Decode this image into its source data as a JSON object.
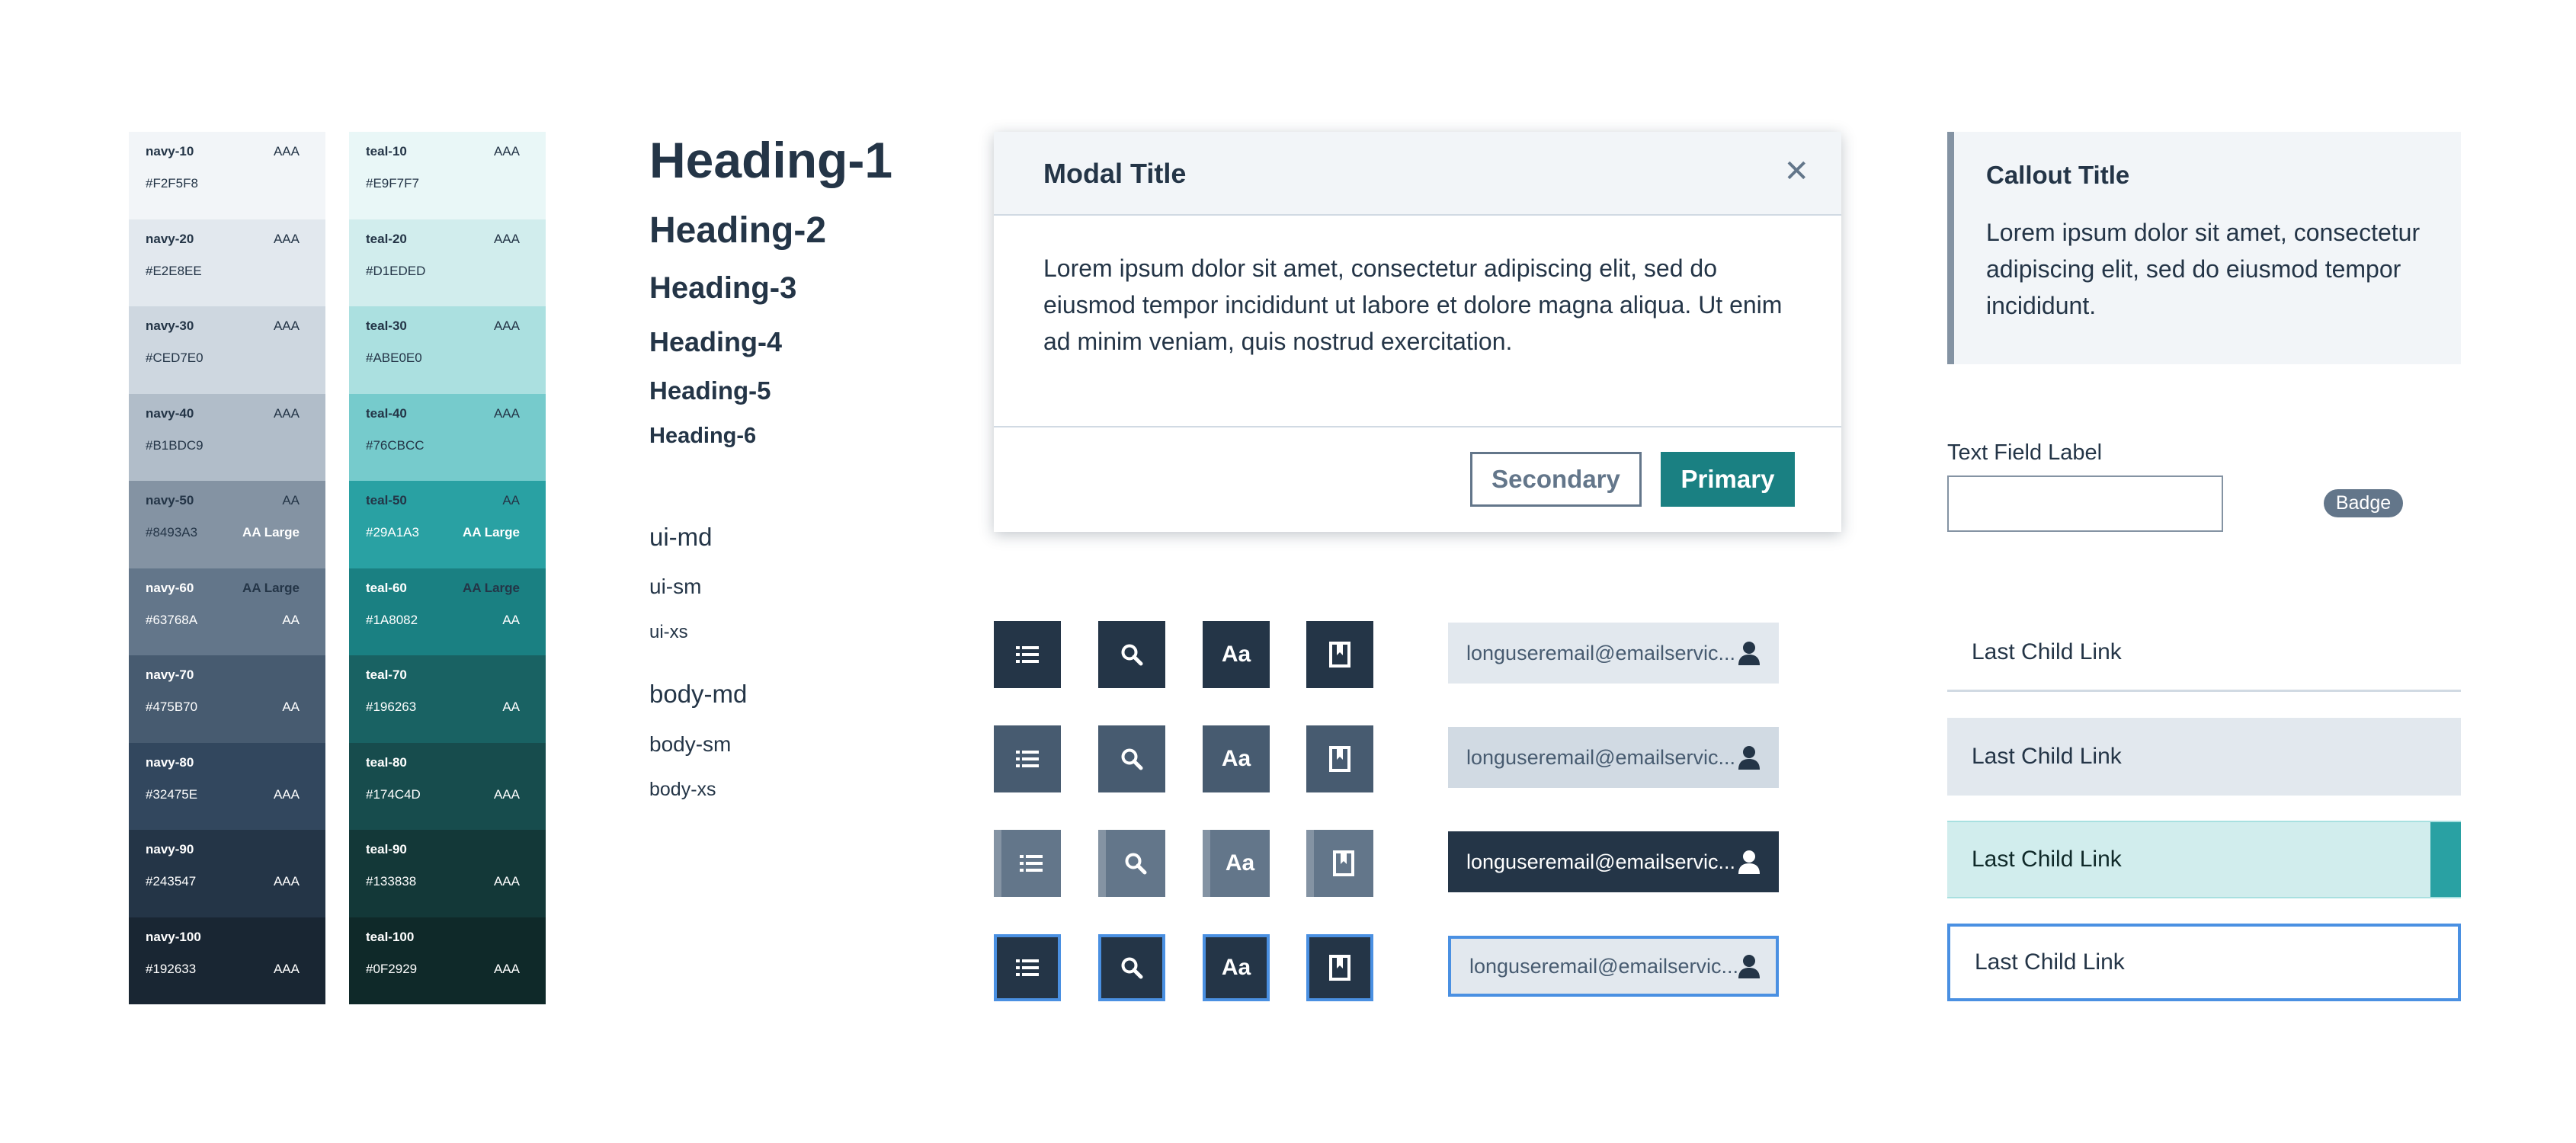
{
  "swatches": {
    "navy": [
      {
        "name": "navy-10",
        "hex": "#F2F5F8",
        "r1": "AAA",
        "r2": "",
        "bg": "#F2F5F8",
        "fg": "#243547",
        "r1bold": false
      },
      {
        "name": "navy-20",
        "hex": "#E2E8EE",
        "r1": "AAA",
        "r2": "",
        "bg": "#E2E8EE",
        "fg": "#243547",
        "r1bold": false
      },
      {
        "name": "navy-30",
        "hex": "#CED7E0",
        "r1": "AAA",
        "r2": "",
        "bg": "#CED7E0",
        "fg": "#243547",
        "r1bold": false
      },
      {
        "name": "navy-40",
        "hex": "#B1BDC9",
        "r1": "AAA",
        "r2": "",
        "bg": "#B1BDC9",
        "fg": "#243547",
        "r1bold": false
      },
      {
        "name": "navy-50",
        "hex": "#8493A3",
        "r1": "AA",
        "r2": "AA Large",
        "bg": "#8493A3",
        "fg": "#FFFFFF",
        "r1bold": false,
        "r2fg": "#FFFFFF",
        "namefg": "#243547",
        "hexfg": "#243547",
        "r1fg": "#243547"
      },
      {
        "name": "navy-60",
        "hex": "#63768A",
        "r1": "AA Large",
        "r2": "AA",
        "bg": "#63768A",
        "fg": "#FFFFFF",
        "r1bold": true,
        "namefg": "#FFFFFF",
        "hexfg": "#FFFFFF",
        "r1fg": "#243547",
        "r2fg": "#FFFFFF"
      },
      {
        "name": "navy-70",
        "hex": "#475B70",
        "r1": "",
        "r2": "AA",
        "bg": "#475B70",
        "fg": "#FFFFFF",
        "r1bold": false
      },
      {
        "name": "navy-80",
        "hex": "#32475E",
        "r1": "",
        "r2": "AAA",
        "bg": "#32475E",
        "fg": "#FFFFFF",
        "r1bold": false
      },
      {
        "name": "navy-90",
        "hex": "#243547",
        "r1": "",
        "r2": "AAA",
        "bg": "#243547",
        "fg": "#FFFFFF",
        "r1bold": false
      },
      {
        "name": "navy-100",
        "hex": "#192633",
        "r1": "",
        "r2": "AAA",
        "bg": "#192633",
        "fg": "#FFFFFF",
        "r1bold": false
      }
    ],
    "teal": [
      {
        "name": "teal-10",
        "hex": "#E9F7F7",
        "r1": "AAA",
        "r2": "",
        "bg": "#E9F7F7",
        "fg": "#243547",
        "r1bold": false
      },
      {
        "name": "teal-20",
        "hex": "#D1EDED",
        "r1": "AAA",
        "r2": "",
        "bg": "#D1EDED",
        "fg": "#243547",
        "r1bold": false
      },
      {
        "name": "teal-30",
        "hex": "#ABE0E0",
        "r1": "AAA",
        "r2": "",
        "bg": "#ABE0E0",
        "fg": "#243547",
        "r1bold": false
      },
      {
        "name": "teal-40",
        "hex": "#76CBCC",
        "r1": "AAA",
        "r2": "",
        "bg": "#76CBCC",
        "fg": "#243547",
        "r1bold": false
      },
      {
        "name": "teal-50",
        "hex": "#29A1A3",
        "r1": "AA",
        "r2": "AA Large",
        "bg": "#29A1A3",
        "fg": "#FFFFFF",
        "r1bold": false,
        "namefg": "#243547",
        "hexfg": "#FFFFFF",
        "r1fg": "#243547",
        "r2fg": "#FFFFFF"
      },
      {
        "name": "teal-60",
        "hex": "#1A8082",
        "r1": "AA Large",
        "r2": "AA",
        "bg": "#1A8082",
        "fg": "#FFFFFF",
        "r1bold": true,
        "namefg": "#FFFFFF",
        "hexfg": "#FFFFFF",
        "r1fg": "#243547",
        "r2fg": "#FFFFFF"
      },
      {
        "name": "teal-70",
        "hex": "#196263",
        "r1": "",
        "r2": "AA",
        "bg": "#196263",
        "fg": "#FFFFFF",
        "r1bold": false
      },
      {
        "name": "teal-80",
        "hex": "#174C4D",
        "r1": "",
        "r2": "AAA",
        "bg": "#174C4D",
        "fg": "#FFFFFF",
        "r1bold": false
      },
      {
        "name": "teal-90",
        "hex": "#133838",
        "r1": "",
        "r2": "AAA",
        "bg": "#133838",
        "fg": "#FFFFFF",
        "r1bold": false
      },
      {
        "name": "teal-100",
        "hex": "#0F2929",
        "r1": "",
        "r2": "AAA",
        "bg": "#0F2929",
        "fg": "#FFFFFF",
        "r1bold": false
      }
    ]
  },
  "typography": {
    "h1": "Heading-1",
    "h2": "Heading-2",
    "h3": "Heading-3",
    "h4": "Heading-4",
    "h5": "Heading-5",
    "h6": "Heading-6",
    "ui_md": "ui-md",
    "ui_sm": "ui-sm",
    "ui_xs": "ui-xs",
    "body_md": "body-md",
    "body_sm": "body-sm",
    "body_xs": "body-xs"
  },
  "modal": {
    "title": "Modal Title",
    "close_icon": "close-icon",
    "body": "Lorem ipsum dolor sit amet, consectetur adipiscing elit, sed do eiusmod tempor incididunt ut labore et dolore magna aliqua. Ut enim ad minim veniam, quis nostrud exercitation.",
    "secondary_label": "Secondary",
    "primary_label": "Primary"
  },
  "icon_buttons": {
    "icons": [
      "list-icon",
      "search-icon",
      "font-icon",
      "bookmark-icon"
    ],
    "font_label": "Aa",
    "states": [
      "default",
      "hover",
      "disabled",
      "focus"
    ]
  },
  "user_pills": {
    "email": "longuseremail@emailservic...",
    "icon": "user-icon"
  },
  "callout": {
    "title": "Callout Title",
    "body": "Lorem ipsum dolor sit amet, consectetur adipiscing elit, sed do eiusmod tempor incididunt."
  },
  "text_field": {
    "label": "Text Field Label",
    "value": ""
  },
  "badge": "Badge",
  "links": {
    "default": "Last Child Link",
    "hover": "Last Child Link",
    "active": "Last Child Link",
    "focus": "Last Child Link"
  },
  "colors": {
    "navy": "#243547",
    "teal": "#1A8082",
    "focus": "#4A90E2"
  }
}
